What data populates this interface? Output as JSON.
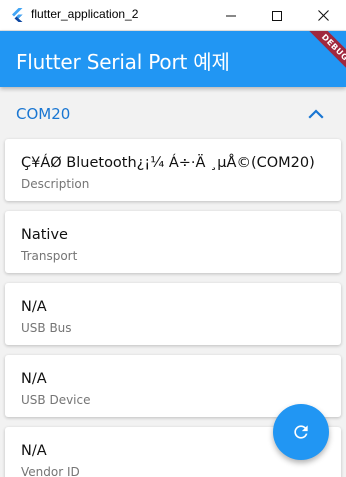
{
  "window": {
    "title": "flutter_application_2"
  },
  "appbar": {
    "title": "Flutter Serial Port 예제",
    "debug_banner": "DEBUG"
  },
  "port": {
    "name": "COM20",
    "expanded": true
  },
  "details": [
    {
      "value": "Ç¥ÁØ Bluetooth¿¡¼ Á÷·Ä ¸µÅ©(COM20)",
      "label": "Description"
    },
    {
      "value": "Native",
      "label": "Transport"
    },
    {
      "value": "N/A",
      "label": "USB Bus"
    },
    {
      "value": "N/A",
      "label": "USB Device"
    },
    {
      "value": "N/A",
      "label": "Vendor ID"
    }
  ],
  "colors": {
    "primary": "#2196f3",
    "accent_text": "#1976d2",
    "debug_banner": "#a0283e"
  },
  "icons": {
    "app": "flutter-logo-icon",
    "expander": "chevron-up-icon",
    "fab": "refresh-icon"
  }
}
